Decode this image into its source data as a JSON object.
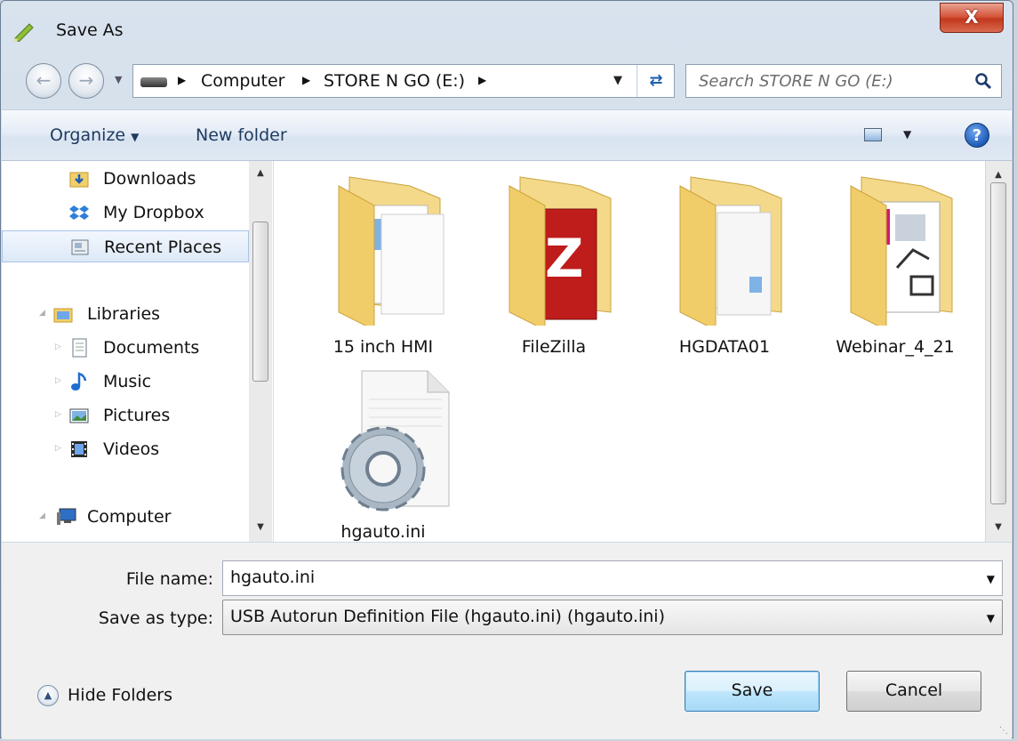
{
  "window": {
    "title": "Save As",
    "close_label": "X"
  },
  "address": {
    "crumbs": [
      "Computer",
      "STORE N GO (E:)"
    ],
    "search_placeholder": "Search STORE N GO (E:)"
  },
  "toolbar": {
    "organize_label": "Organize",
    "new_folder_label": "New folder",
    "help_label": "?"
  },
  "nav": {
    "items": [
      {
        "label": "Downloads",
        "icon": "downloads-folder-icon"
      },
      {
        "label": "My Dropbox",
        "icon": "dropbox-icon"
      },
      {
        "label": "Recent Places",
        "icon": "recent-places-icon",
        "selected": true
      },
      {
        "label": "Libraries",
        "icon": "libraries-icon"
      },
      {
        "label": "Documents",
        "icon": "documents-icon"
      },
      {
        "label": "Music",
        "icon": "music-icon"
      },
      {
        "label": "Pictures",
        "icon": "pictures-icon"
      },
      {
        "label": "Videos",
        "icon": "videos-icon"
      },
      {
        "label": "Computer",
        "icon": "computer-icon"
      }
    ]
  },
  "files": [
    {
      "name": "15 inch HMI",
      "type": "folder"
    },
    {
      "name": "FileZilla",
      "type": "folder"
    },
    {
      "name": "HGDATA01",
      "type": "folder"
    },
    {
      "name": "Webinar_4_21",
      "type": "folder"
    },
    {
      "name": "hgauto.ini",
      "type": "settings-file"
    }
  ],
  "form": {
    "file_name_label": "File name:",
    "file_name_value": "hgauto.ini",
    "save_type_label": "Save as type:",
    "save_type_value": "USB Autorun Definition File (hgauto.ini) (hgauto.ini)"
  },
  "footer": {
    "hide_folders_label": "Hide Folders",
    "save_label": "Save",
    "cancel_label": "Cancel"
  },
  "colors": {
    "accent": "#1e5fae",
    "selection": "#dde9f7",
    "close": "#c2391d"
  }
}
